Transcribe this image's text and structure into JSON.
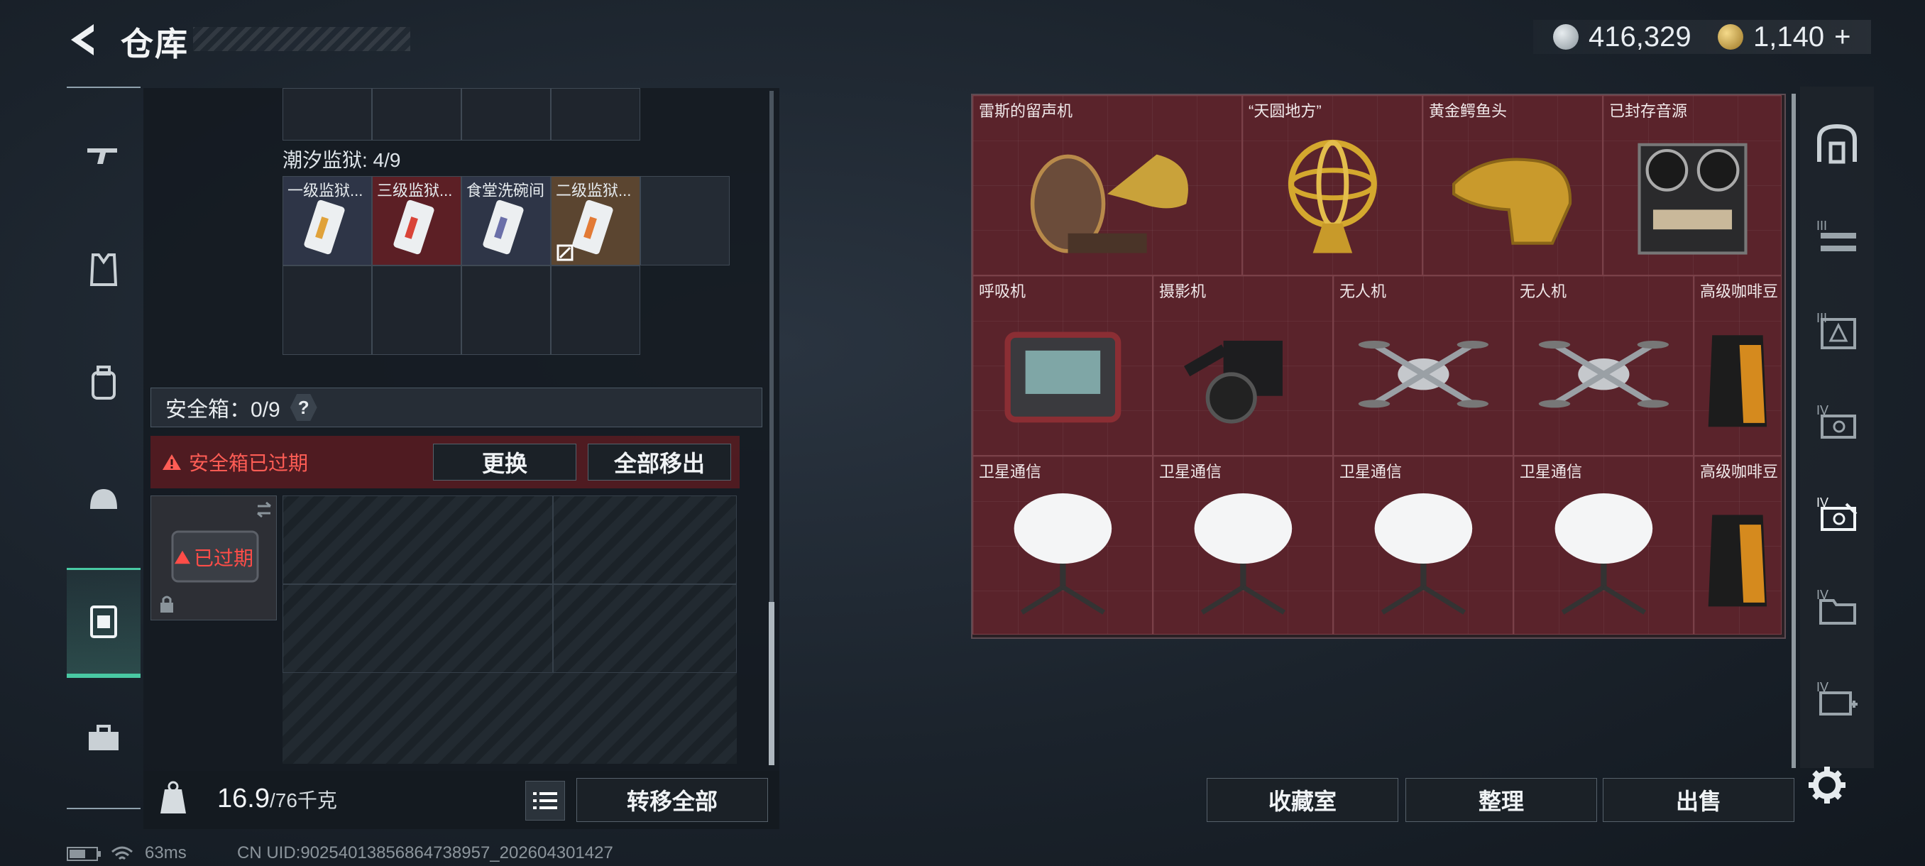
{
  "header": {
    "title": "仓库",
    "back_icon": "back-arrow-icon",
    "currency_1": {
      "icon": "silver-coin-icon",
      "value": "416,329",
      "color": "#b9c1c7"
    },
    "currency_2": {
      "icon": "gold-coin-icon",
      "value": "1,140",
      "plus": "+",
      "color": "#c8a042"
    }
  },
  "left_sidebar": {
    "items": [
      {
        "icon": "rifle-icon"
      },
      {
        "icon": "armor-vest-icon"
      },
      {
        "icon": "backpack-icon"
      },
      {
        "icon": "helmet-icon"
      },
      {
        "icon": "safe-box-icon",
        "active": true
      },
      {
        "icon": "toolbox-icon"
      }
    ]
  },
  "storage": {
    "section_label": "潮汐监狱: 4/9",
    "items": [
      {
        "title": "一级监狱...",
        "color": "#2e3547"
      },
      {
        "title": "三级监狱...",
        "color": "#5c1f25"
      },
      {
        "title": "食堂洗碗间",
        "color": "#2e3547"
      },
      {
        "title": "二级监狱...",
        "color": "#5b4530"
      }
    ]
  },
  "safe_box": {
    "label": "安全箱：0/9",
    "help": "?",
    "expired_warning": "安全箱已过期",
    "replace_button": "更换",
    "remove_all_button": "全部移出",
    "expired_tag": "已过期"
  },
  "bottom_left": {
    "weight_current": "16.9",
    "weight_total": "/76千克",
    "transfer_all_button": "转移全部"
  },
  "status_bar": {
    "ping": "63ms",
    "uid": "CN UID:90254013856864738957_202604301427"
  },
  "right_items": [
    {
      "title": "雷斯的留声机",
      "art": "gramophone-icon"
    },
    {
      "title": "“天圆地方”",
      "art": "armillary-sphere-icon"
    },
    {
      "title": "黄金鳄鱼头",
      "art": "gold-crocodile-head-icon"
    },
    {
      "title": "已封存音源",
      "art": "reel-to-reel-recorder-icon"
    },
    {
      "title": "呼吸机",
      "art": "ventilator-icon"
    },
    {
      "title": "摄影机",
      "art": "film-camera-icon"
    },
    {
      "title": "无人机",
      "art": "drone-icon"
    },
    {
      "title": "无人机",
      "art": "drone-icon"
    },
    {
      "title": "高级咖啡豆",
      "art": "coffee-bag-icon"
    },
    {
      "title": "卫星通信",
      "art": "satellite-dish-icon"
    },
    {
      "title": "卫星通信",
      "art": "satellite-dish-icon"
    },
    {
      "title": "卫星通信",
      "art": "satellite-dish-icon"
    },
    {
      "title": "卫星通信",
      "art": "satellite-dish-icon"
    },
    {
      "title": "高级咖啡豆",
      "art": "coffee-bag-icon"
    }
  ],
  "right_sidebar": {
    "items": [
      {
        "icon": "vault-door-icon"
      },
      {
        "icon": "tier-3-shelf-icon"
      },
      {
        "icon": "tier-3-warning-icon"
      },
      {
        "icon": "tier-4-monitor-icon"
      },
      {
        "icon": "tier-4-tools-icon",
        "active": true
      },
      {
        "icon": "tier-4-folder-icon"
      },
      {
        "icon": "tier-4-medkit-icon"
      }
    ]
  },
  "bottom_right": {
    "collection_button": "收藏室",
    "organize_button": "整理",
    "sell_button": "出售",
    "settings_icon": "gear-icon"
  }
}
